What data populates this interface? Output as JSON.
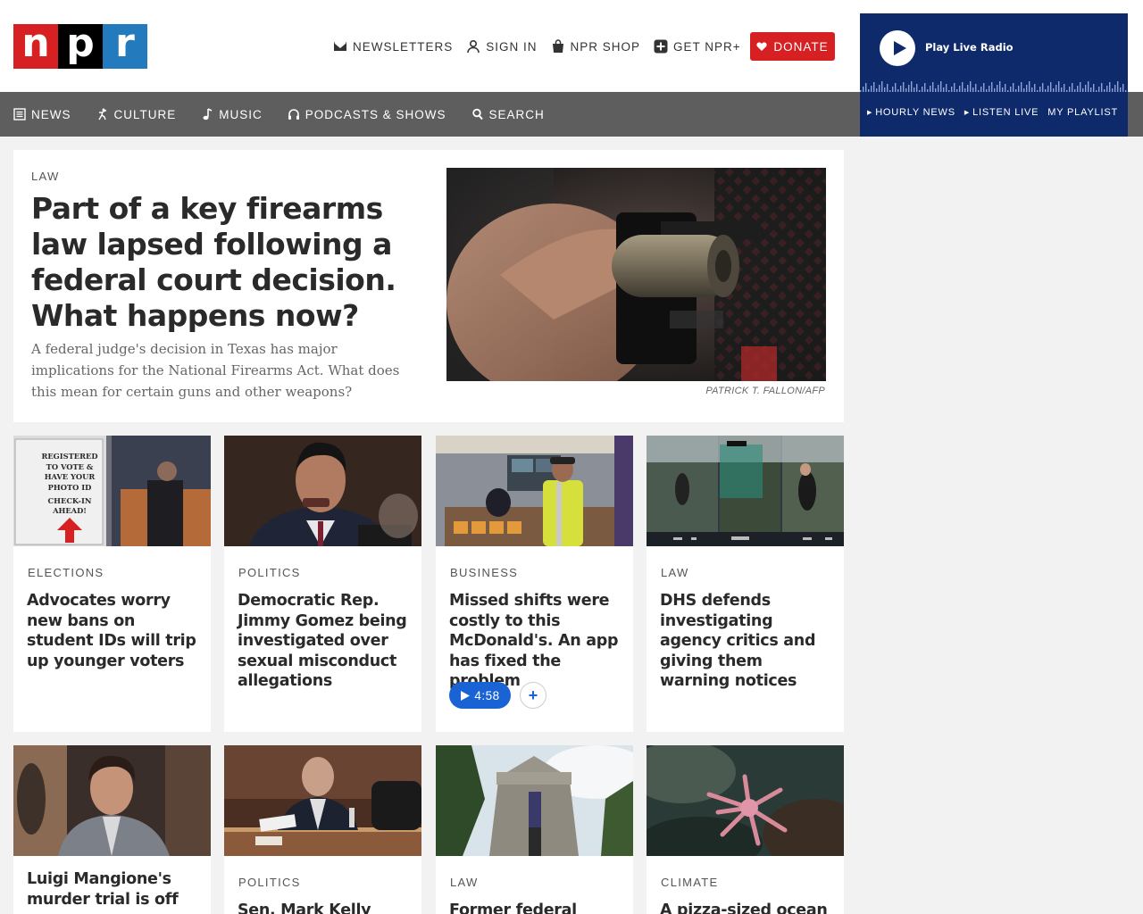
{
  "header": {
    "logo": {
      "n": "n",
      "p": "p",
      "r": "r"
    },
    "utility": [
      {
        "label": "NEWSLETTERS",
        "icon": "envelope-icon"
      },
      {
        "label": "SIGN IN",
        "icon": "user-icon"
      },
      {
        "label": "NPR SHOP",
        "icon": "shopping-bag-icon"
      },
      {
        "label": "GET NPR+",
        "icon": "plus-square-icon"
      }
    ],
    "donate_label": "DONATE"
  },
  "nav": [
    {
      "label": "NEWS",
      "icon": "newspaper-icon"
    },
    {
      "label": "CULTURE",
      "icon": "dancer-icon"
    },
    {
      "label": "MUSIC",
      "icon": "music-note-icon"
    },
    {
      "label": "PODCASTS & SHOWS",
      "icon": "headphones-icon"
    },
    {
      "label": "SEARCH",
      "icon": "search-icon"
    }
  ],
  "player": {
    "live_label": "Play Live Radio",
    "links": [
      "HOURLY NEWS",
      "LISTEN LIVE",
      "MY PLAYLIST"
    ]
  },
  "featured": {
    "kicker": "LAW",
    "headline": "Part of a key firearms law lapsed following a federal court decision. What happens now?",
    "teaser": "A federal judge's decision in Texas has major implications for the National Firearms Act. What does this mean for certain guns and other weapons?",
    "credit": "PATRICK T. FALLON/AFP"
  },
  "cards": [
    {
      "kicker": "ELECTIONS",
      "headline": "Advocates worry new bans on student IDs will trip up younger voters"
    },
    {
      "kicker": "POLITICS",
      "headline": "Democratic Rep. Jimmy Gomez being investigated over sexual misconduct allegations"
    },
    {
      "kicker": "BUSINESS",
      "headline": "Missed shifts were costly to this McDonald's. An app has fixed the problem",
      "audio": "4:58",
      "add": "+"
    },
    {
      "kicker": "LAW",
      "headline": "DHS defends investigating agency critics and giving them warning notices"
    },
    {
      "kicker": "",
      "headline": "Luigi Mangione's murder trial is off as"
    },
    {
      "kicker": "POLITICS",
      "headline": "Sen. Mark Kelly says"
    },
    {
      "kicker": "LAW",
      "headline": "Former federal"
    },
    {
      "kicker": "CLIMATE",
      "headline": "A pizza-sized ocean"
    }
  ],
  "sign_text": {
    "line1": "REGISTERED",
    "line2": "TO VOTE &",
    "line3": "HAVE YOUR",
    "line4": "PHOTO ID",
    "line5": "CHECK-IN",
    "line6": "AHEAD!"
  },
  "colors": {
    "npr_red": "#d62021",
    "npr_blue": "#237bbd",
    "player_blue": "#0e2a6b",
    "nav_gray": "#5e5e5e",
    "audio_blue": "#1a63d4"
  }
}
